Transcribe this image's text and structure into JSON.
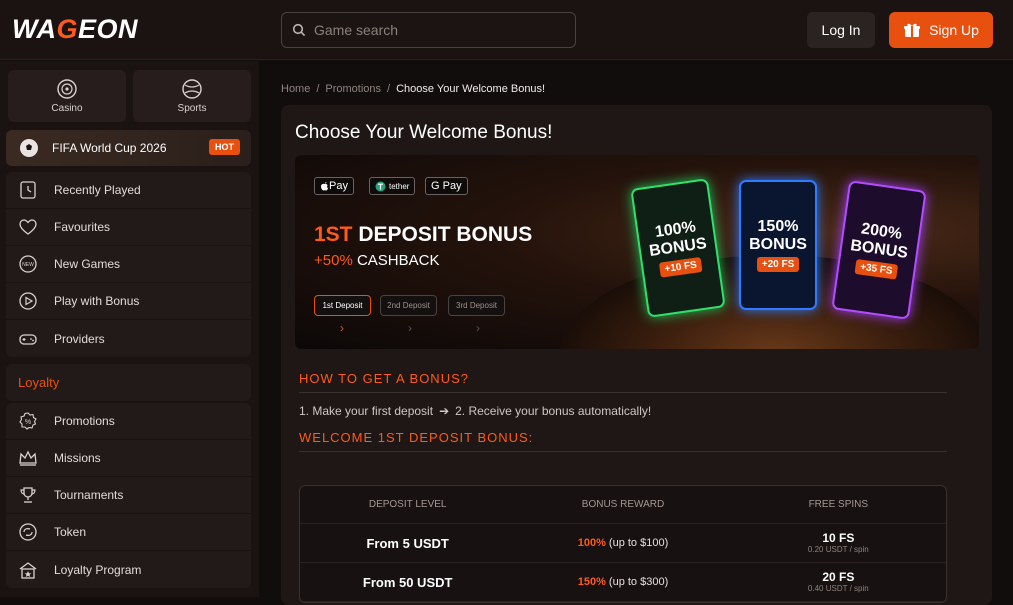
{
  "header": {
    "logo_pre": "WA",
    "logo_g": "G",
    "logo_post": "EON",
    "search_placeholder": "Game search",
    "login_label": "Log In",
    "signup_label": "Sign Up"
  },
  "sidebar": {
    "categories": [
      {
        "label": "Casino",
        "icon": "roulette-icon"
      },
      {
        "label": "Sports",
        "icon": "ball-icon"
      }
    ],
    "featured": {
      "label": "FIFA World Cup 2026",
      "badge": "HOT"
    },
    "items": [
      {
        "label": "Recently Played",
        "icon": "clock-icon"
      },
      {
        "label": "Favourites",
        "icon": "heart-icon"
      },
      {
        "label": "New Games",
        "icon": "new-badge-icon"
      },
      {
        "label": "Play with Bonus",
        "icon": "play-icon"
      },
      {
        "label": "Providers",
        "icon": "gamepad-icon"
      }
    ],
    "loyalty_heading": "Loyalty",
    "loyalty_items": [
      {
        "label": "Promotions",
        "icon": "percent-icon"
      },
      {
        "label": "Missions",
        "icon": "crown-icon"
      },
      {
        "label": "Tournaments",
        "icon": "trophy-icon"
      },
      {
        "label": "Token",
        "icon": "token-icon"
      },
      {
        "label": "Loyalty Program",
        "icon": "loyalty-icon"
      }
    ]
  },
  "breadcrumb": {
    "home": "Home",
    "promotions": "Promotions",
    "current": "Choose Your Welcome Bonus!"
  },
  "page": {
    "title": "Choose Your Welcome Bonus!"
  },
  "banner": {
    "payments": [
      "Pay",
      "tether",
      "G Pay"
    ],
    "headline_accent": "1ST",
    "headline_rest": "DEPOSIT BONUS",
    "sub_accent": "+50%",
    "sub_rest": "CASHBACK",
    "deposit_tabs": [
      "1st Deposit",
      "2nd Deposit",
      "3rd Deposit"
    ],
    "cards": [
      {
        "pct": "100%",
        "word": "BONUS",
        "fs": "+10 FS"
      },
      {
        "pct": "150%",
        "word": "BONUS",
        "fs": "+20 FS"
      },
      {
        "pct": "200%",
        "word": "BONUS",
        "fs": "+35 FS"
      }
    ]
  },
  "howto": {
    "heading": "HOW TO GET A BONUS?",
    "step1": "1. Make your first deposit",
    "arrow": "➔",
    "step2": "2. Receive your bonus automatically!",
    "welcome_heading": "WELCOME 1ST DEPOSIT BONUS:"
  },
  "table": {
    "headers": [
      "DEPOSIT LEVEL",
      "BONUS REWARD",
      "FREE SPINS"
    ],
    "rows": [
      {
        "level": "From 5 USDT",
        "reward_pct": "100%",
        "reward_rest": "(up to $100)",
        "spins": "10 FS",
        "spin_value": "0.20 USDT / spin"
      },
      {
        "level": "From 50 USDT",
        "reward_pct": "150%",
        "reward_rest": "(up to $300)",
        "spins": "20 FS",
        "spin_value": "0.40 USDT / spin"
      }
    ]
  },
  "colors": {
    "accent": "#e8500f",
    "background": "#120d0d",
    "sidebar": "#1a1312"
  }
}
